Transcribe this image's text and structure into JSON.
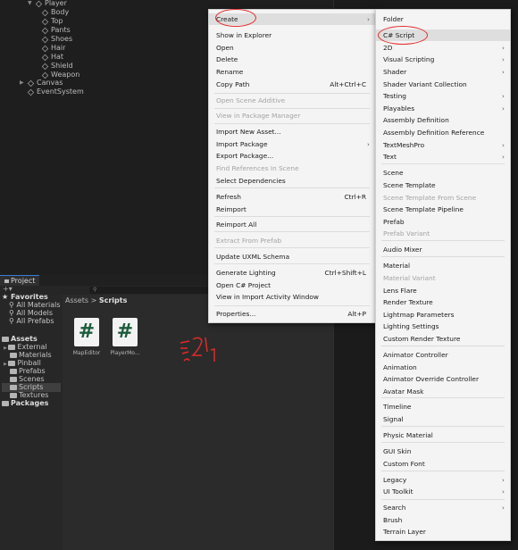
{
  "hierarchy": {
    "player": "Player",
    "children": [
      "Body",
      "Top",
      "Pants",
      "Shoes",
      "Hair",
      "Hat",
      "Shield",
      "Weapon"
    ],
    "canvas": "Canvas",
    "event_system": "EventSystem"
  },
  "project": {
    "tab_label": "Project",
    "favorites_label": "Favorites",
    "favorites": [
      "All Materials",
      "All Models",
      "All Prefabs"
    ],
    "assets_label": "Assets",
    "asset_folders": [
      "External",
      "Materials",
      "Pinball",
      "Prefabs",
      "Scenes",
      "Scripts",
      "Textures"
    ],
    "packages_label": "Packages",
    "breadcrumb_root": "Assets",
    "breadcrumb_sep": ">",
    "breadcrumb_current": "Scripts",
    "files": [
      {
        "name": "MapEditor",
        "icon": "#"
      },
      {
        "name": "PlayerMo...",
        "icon": "#"
      }
    ]
  },
  "main_menu": [
    {
      "label": "Create",
      "submenu": true,
      "highlight": true
    },
    {
      "label": "Show in Explorer"
    },
    {
      "label": "Open"
    },
    {
      "label": "Delete"
    },
    {
      "label": "Rename"
    },
    {
      "label": "Copy Path",
      "shortcut": "Alt+Ctrl+C"
    },
    {
      "label": "Open Scene Additive",
      "disabled": true
    },
    {
      "label": "View in Package Manager",
      "disabled": true
    },
    {
      "label": "Import New Asset..."
    },
    {
      "label": "Import Package",
      "submenu": true
    },
    {
      "label": "Export Package..."
    },
    {
      "label": "Find References In Scene",
      "disabled": true
    },
    {
      "label": "Select Dependencies"
    },
    {
      "label": "Refresh",
      "shortcut": "Ctrl+R"
    },
    {
      "label": "Reimport"
    },
    {
      "label": "Reimport All"
    },
    {
      "label": "Extract From Prefab",
      "disabled": true
    },
    {
      "label": "Update UXML Schema"
    },
    {
      "label": "Generate Lighting",
      "shortcut": "Ctrl+Shift+L"
    },
    {
      "label": "Open C# Project"
    },
    {
      "label": "View in Import Activity Window"
    },
    {
      "label": "Properties...",
      "shortcut": "Alt+P"
    }
  ],
  "create_menu": [
    {
      "label": "Folder"
    },
    {
      "label": "C# Script",
      "highlight": true
    },
    {
      "label": "2D",
      "submenu": true
    },
    {
      "label": "Visual Scripting",
      "submenu": true
    },
    {
      "label": "Shader",
      "submenu": true
    },
    {
      "label": "Shader Variant Collection"
    },
    {
      "label": "Testing",
      "submenu": true
    },
    {
      "label": "Playables",
      "submenu": true
    },
    {
      "label": "Assembly Definition"
    },
    {
      "label": "Assembly Definition Reference"
    },
    {
      "label": "TextMeshPro",
      "submenu": true
    },
    {
      "label": "Text",
      "submenu": true
    },
    {
      "label": "Scene"
    },
    {
      "label": "Scene Template"
    },
    {
      "label": "Scene Template From Scene",
      "disabled": true
    },
    {
      "label": "Scene Template Pipeline"
    },
    {
      "label": "Prefab"
    },
    {
      "label": "Prefab Variant",
      "disabled": true
    },
    {
      "label": "Audio Mixer"
    },
    {
      "label": "Material"
    },
    {
      "label": "Material Variant",
      "disabled": true
    },
    {
      "label": "Lens Flare"
    },
    {
      "label": "Render Texture"
    },
    {
      "label": "Lightmap Parameters"
    },
    {
      "label": "Lighting Settings"
    },
    {
      "label": "Custom Render Texture"
    },
    {
      "label": "Animator Controller"
    },
    {
      "label": "Animation"
    },
    {
      "label": "Animator Override Controller"
    },
    {
      "label": "Avatar Mask"
    },
    {
      "label": "Timeline"
    },
    {
      "label": "Signal"
    },
    {
      "label": "Physic Material"
    },
    {
      "label": "GUI Skin"
    },
    {
      "label": "Custom Font"
    },
    {
      "label": "Legacy",
      "submenu": true
    },
    {
      "label": "UI Toolkit",
      "submenu": true
    },
    {
      "label": "Search",
      "submenu": true
    },
    {
      "label": "Brush"
    },
    {
      "label": "Terrain Layer"
    }
  ],
  "colors": {
    "annotation": "#e22a2a",
    "menu_bg": "#f4f4f4"
  }
}
